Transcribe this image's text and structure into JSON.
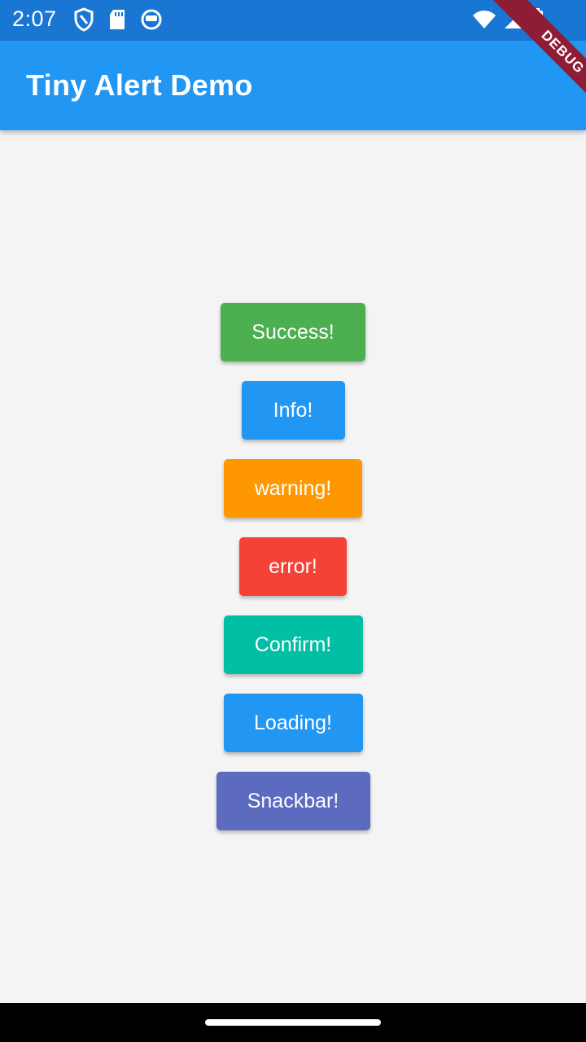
{
  "status_bar": {
    "time": "2:07",
    "icons_left": [
      "shield-icon",
      "sd-card-icon",
      "app-status-icon"
    ],
    "icons_right": [
      "wifi-icon",
      "signal-icon",
      "battery-icon"
    ]
  },
  "app_bar": {
    "title": "Tiny Alert Demo",
    "color": "#2196f3"
  },
  "debug_banner": "DEBUG",
  "buttons": [
    {
      "label": "Success!",
      "color": "#4caf50"
    },
    {
      "label": "Info!",
      "color": "#2196f3"
    },
    {
      "label": "warning!",
      "color": "#ff9800"
    },
    {
      "label": "error!",
      "color": "#f44336"
    },
    {
      "label": "Confirm!",
      "color": "#00bfa5"
    },
    {
      "label": "Loading!",
      "color": "#2196f3"
    },
    {
      "label": "Snackbar!",
      "color": "#5c6bc0"
    }
  ]
}
